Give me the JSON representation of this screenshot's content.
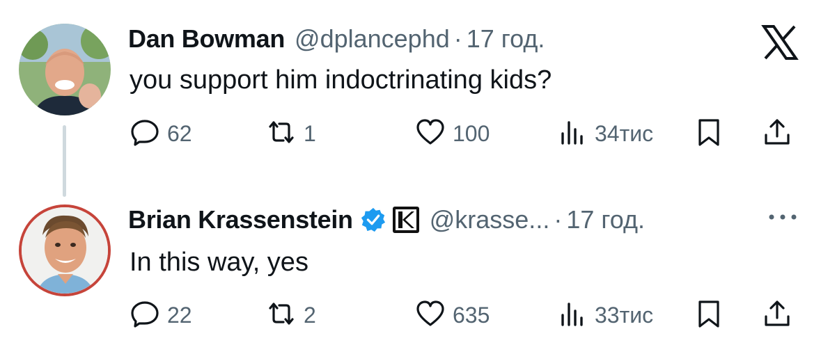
{
  "tweets": [
    {
      "author_name": "Dan Bowman",
      "handle": "@dplancephd",
      "separator": "·",
      "time": "17 год.",
      "text": "you support him indoctrinating kids?",
      "reply_count": "62",
      "repost_count": "1",
      "like_count": "100",
      "views_count": "34тис",
      "icons": [
        "reply-icon",
        "repost-icon",
        "like-icon",
        "views-icon",
        "bookmark-icon",
        "share-icon"
      ]
    },
    {
      "author_name": "Brian Krassenstein",
      "handle": "@krasse...",
      "separator": "·",
      "time": "17 год.",
      "text": "In this way, yes",
      "reply_count": "22",
      "repost_count": "2",
      "like_count": "635",
      "views_count": "33тис",
      "badges": [
        "verified-icon",
        "affiliate-k-badge"
      ]
    }
  ],
  "colors": {
    "text_primary": "#0f1419",
    "text_secondary": "#536471",
    "verified_blue": "#1d9bf0",
    "thread_line": "#cfd9de"
  },
  "brand_icon": "x-logo-icon",
  "overflow_icon": "more-icon"
}
